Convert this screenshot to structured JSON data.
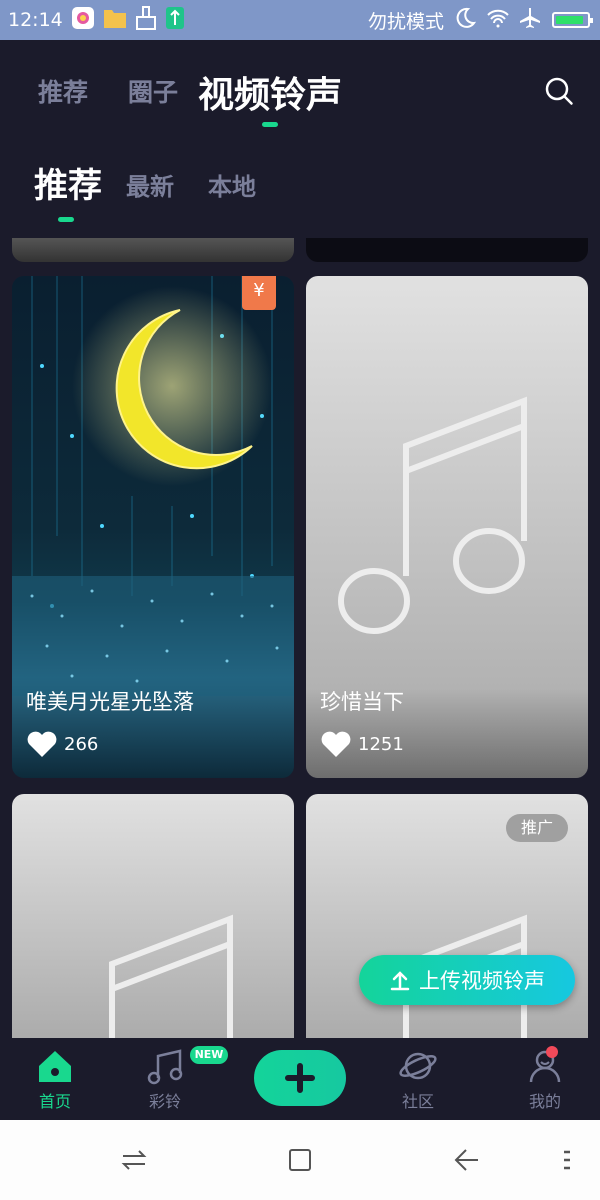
{
  "status_bar": {
    "time": "12:14",
    "dnd_label": "勿扰模式"
  },
  "top_nav": {
    "tabs": [
      {
        "label": "推荐"
      },
      {
        "label": "圈子"
      },
      {
        "label": "视频铃声"
      }
    ],
    "active_tab": "视频铃声"
  },
  "sub_nav": {
    "tabs": [
      {
        "label": "推荐"
      },
      {
        "label": "最新"
      },
      {
        "label": "本地"
      }
    ],
    "active_tab": "推荐"
  },
  "cards": [
    {
      "title": "唯美月光星光坠落",
      "likes": "266",
      "badge": "¥"
    },
    {
      "title": "珍惜当下",
      "likes": "1251",
      "badge": ""
    },
    {
      "title": "",
      "likes": "",
      "badge": ""
    },
    {
      "title": "",
      "likes": "",
      "badge": "推广"
    }
  ],
  "upload_button": {
    "label": "上传视频铃声"
  },
  "tab_bar": {
    "items": [
      {
        "label": "首页",
        "icon": "home-icon"
      },
      {
        "label": "彩铃",
        "icon": "music-note-icon"
      },
      {
        "label": "",
        "icon": "plus-icon"
      },
      {
        "label": "社区",
        "icon": "planet-icon"
      },
      {
        "label": "我的",
        "icon": "person-icon"
      }
    ],
    "new_badge": "NEW"
  },
  "colors": {
    "accent": "#19d88e",
    "background": "#1b1b2b",
    "status_bar": "#7f97c8",
    "inactive": "#7b7f9a",
    "price_badge": "#f0794a"
  }
}
